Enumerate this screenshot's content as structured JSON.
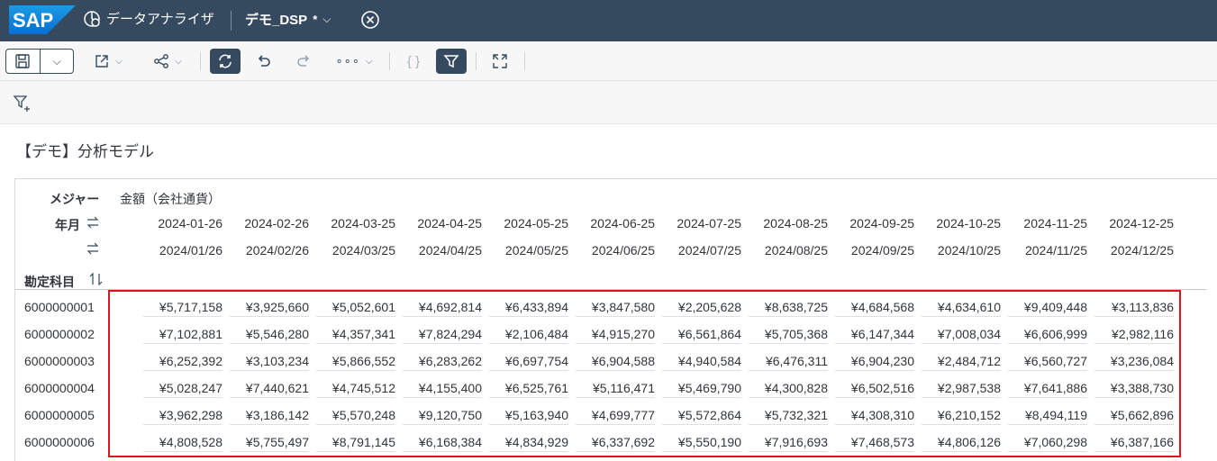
{
  "shell": {
    "logo_text": "SAP",
    "app_name": "データアナライザ",
    "doc_title": "デモ_DSP",
    "doc_modified": "*",
    "colors": {
      "bar": "#354a5f",
      "logo": "#0a6ed1",
      "highlight": "#e0121b"
    }
  },
  "toolbar": {
    "items": [
      "save-icon",
      "dropdown-caret",
      "export-icon",
      "share-icon",
      "refresh-icon",
      "undo-icon",
      "redo-icon",
      "more-icon",
      "formula-icon",
      "filter-icon",
      "fullscreen-icon"
    ]
  },
  "model_title": "【デモ】分析モデル",
  "table": {
    "measure_label": "メジャー",
    "measure_value": "金額（会社通貨）",
    "yearmonth_label": "年月",
    "account_label": "勘定科目",
    "dates": [
      "2024-01-26",
      "2024-02-26",
      "2024-03-25",
      "2024-04-25",
      "2024-05-25",
      "2024-06-25",
      "2024-07-25",
      "2024-08-25",
      "2024-09-25",
      "2024-10-25",
      "2024-11-25",
      "2024-12-25"
    ],
    "dates_alt": [
      "2024/01/26",
      "2024/02/26",
      "2024/03/25",
      "2024/04/25",
      "2024/05/25",
      "2024/06/25",
      "2024/07/25",
      "2024/08/25",
      "2024/09/25",
      "2024/10/25",
      "2024/11/25",
      "2024/12/25"
    ],
    "rows": [
      {
        "account": "6000000001",
        "values": [
          "¥5,717,158",
          "¥3,925,660",
          "¥5,052,601",
          "¥4,692,814",
          "¥6,433,894",
          "¥3,847,580",
          "¥2,205,628",
          "¥8,638,725",
          "¥4,684,568",
          "¥4,634,610",
          "¥9,409,448",
          "¥3,113,836"
        ]
      },
      {
        "account": "6000000002",
        "values": [
          "¥7,102,881",
          "¥5,546,280",
          "¥4,357,341",
          "¥7,824,294",
          "¥2,106,484",
          "¥4,915,270",
          "¥6,561,864",
          "¥5,705,368",
          "¥6,147,344",
          "¥7,008,034",
          "¥6,606,999",
          "¥2,982,116"
        ]
      },
      {
        "account": "6000000003",
        "values": [
          "¥6,252,392",
          "¥3,103,234",
          "¥5,866,552",
          "¥6,283,262",
          "¥6,697,754",
          "¥6,904,588",
          "¥4,940,584",
          "¥6,476,311",
          "¥6,904,230",
          "¥2,484,712",
          "¥6,560,727",
          "¥3,236,084"
        ]
      },
      {
        "account": "6000000004",
        "values": [
          "¥5,028,247",
          "¥7,440,621",
          "¥4,745,512",
          "¥4,155,400",
          "¥6,525,761",
          "¥5,116,471",
          "¥5,469,790",
          "¥4,300,828",
          "¥6,502,516",
          "¥2,987,538",
          "¥7,641,886",
          "¥3,388,730"
        ]
      },
      {
        "account": "6000000005",
        "values": [
          "¥3,962,298",
          "¥3,186,142",
          "¥5,570,248",
          "¥9,120,750",
          "¥5,163,940",
          "¥4,699,777",
          "¥5,572,864",
          "¥5,732,321",
          "¥4,308,310",
          "¥6,210,152",
          "¥8,494,119",
          "¥5,662,896"
        ]
      },
      {
        "account": "6000000006",
        "values": [
          "¥4,808,528",
          "¥5,755,497",
          "¥8,791,145",
          "¥6,168,384",
          "¥4,834,929",
          "¥6,337,692",
          "¥5,550,190",
          "¥7,916,693",
          "¥7,468,573",
          "¥4,806,126",
          "¥7,060,298",
          "¥6,387,166"
        ]
      }
    ]
  }
}
